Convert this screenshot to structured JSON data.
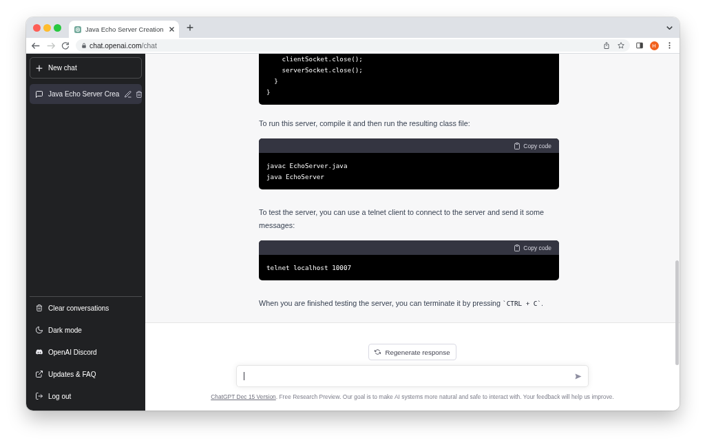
{
  "browser": {
    "tabs": [
      {
        "title": "Java Echo Server Creation",
        "selected": true
      }
    ],
    "nav_buttons": [
      {
        "kind": "back",
        "disabled": false
      },
      {
        "kind": "forward",
        "disabled": true
      },
      {
        "kind": "reload",
        "disabled": false
      }
    ],
    "url": {
      "host": "chat.openai.com",
      "path": "/chat"
    },
    "profile_initial": "H"
  },
  "sidebar": {
    "new_chat": "New chat",
    "conversations": [
      {
        "title": "Java Echo Server Crea",
        "selected": true
      }
    ],
    "menu": [
      {
        "kind": "clear",
        "label": "Clear conversations"
      },
      {
        "kind": "theme",
        "label": "Dark mode"
      },
      {
        "kind": "discord",
        "label": "OpenAI Discord"
      },
      {
        "kind": "external",
        "label": "Updates & FAQ"
      },
      {
        "kind": "logout",
        "label": "Log out"
      }
    ]
  },
  "conversation": {
    "blocks": [
      {
        "kind": "code",
        "lines": [
          "    clientSocket.close();",
          "    serverSocket.close();",
          "  }",
          "}"
        ]
      },
      {
        "kind": "paragraph",
        "segments": [
          {
            "text": "To run this server, compile it and then run the resulting class file:",
            "code": false
          }
        ]
      },
      {
        "kind": "code",
        "copy_label": "Copy code",
        "lines": [
          "javac EchoServer.java",
          "java EchoServer"
        ]
      },
      {
        "kind": "paragraph",
        "segments": [
          {
            "text": "To test the server, you can use a telnet client to connect to the server and send it some messages:",
            "code": false
          }
        ]
      },
      {
        "kind": "code",
        "copy_label": "Copy code",
        "lines": [
          "telnet localhost 10007"
        ]
      },
      {
        "kind": "paragraph",
        "segments": [
          {
            "text": "When you are finished testing the server, you can terminate it by pressing ",
            "code": false
          },
          {
            "text": "`CTRL + C`",
            "code": true
          },
          {
            "text": ".",
            "code": false
          }
        ]
      }
    ]
  },
  "composer": {
    "regenerate": "Regenerate response",
    "input": {
      "focused": true
    }
  },
  "footer": {
    "link": "ChatGPT Dec 15 Version",
    "text": ". Free Research Preview. Our goal is to make AI systems more natural and safe to interact with. Your feedback will help us improve."
  }
}
